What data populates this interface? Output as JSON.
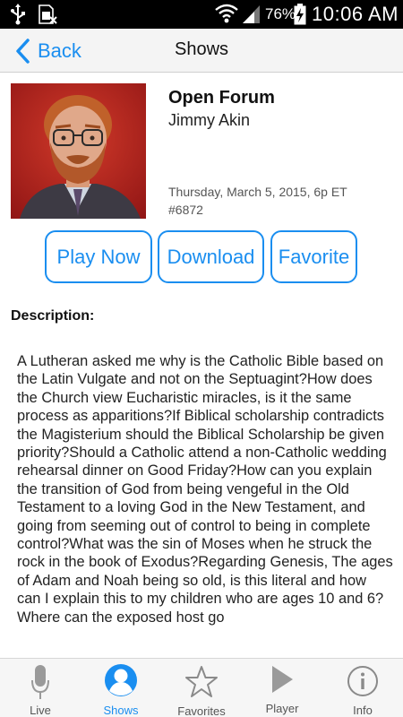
{
  "status_bar": {
    "battery_percent": "76%",
    "time": "10:06 AM",
    "icons": [
      "usb-icon",
      "sim-card-icon",
      "wifi-icon",
      "cell-signal-icon",
      "battery-charging-icon"
    ]
  },
  "nav": {
    "back_label": "Back",
    "title": "Shows"
  },
  "show": {
    "title": "Open Forum",
    "host": "Jimmy Akin",
    "date": "Thursday, March 5, 2015, 6p ET",
    "number": "#6872"
  },
  "actions": {
    "play_label": "Play Now",
    "download_label": "Download",
    "favorite_label": "Favorite"
  },
  "description": {
    "heading": "Description:",
    "text": "A Lutheran asked me why is the Catholic Bible based on the Latin Vulgate and not on the Septuagint?How does the Church view Eucharistic miracles, is it the same process as apparitions?If Biblical scholarship contradicts the Magisterium should the Biblical Scholarship be given priority?Should a Catholic attend a  non-Catholic wedding rehearsal dinner on Good Friday?How can you explain the transition of God from being vengeful in the Old Testament to a loving God in the New Testament, and going from seeming out of control to being in complete control?What was the sin of Moses when he struck the rock in the book of Exodus?Regarding Genesis, The ages of Adam and Noah being so old, is this literal and how can I explain this to my children who are ages 10 and 6?Where can the exposed host go"
  },
  "tabs": [
    {
      "label": "Live",
      "icon": "microphone-icon",
      "active": false
    },
    {
      "label": "Shows",
      "icon": "person-icon",
      "active": true
    },
    {
      "label": "Favorites",
      "icon": "star-icon",
      "active": false
    },
    {
      "label": "Player",
      "icon": "play-icon",
      "active": false
    },
    {
      "label": "Info",
      "icon": "info-icon",
      "active": false
    }
  ],
  "colors": {
    "accent": "#1a8ef0",
    "tab_inactive": "#555555",
    "status_bar": "#000000"
  }
}
